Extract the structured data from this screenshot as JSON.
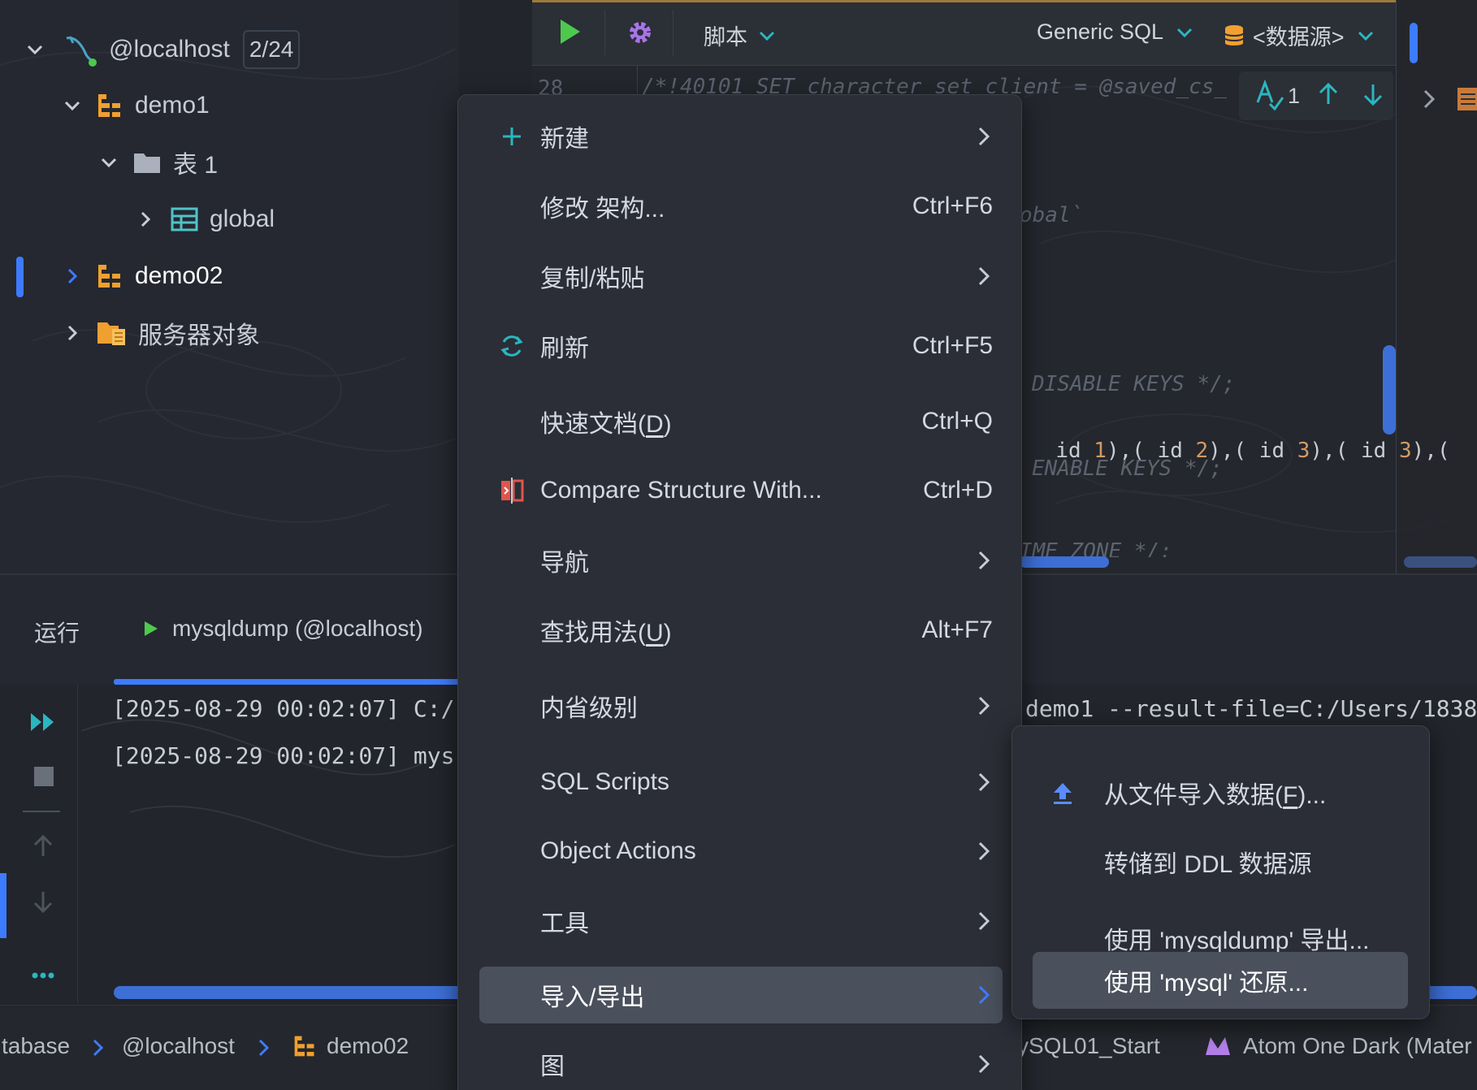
{
  "colors": {
    "accent": "#3d7bff",
    "folder_orange": "#f0a030",
    "run_green": "#4ec94e",
    "gear_purple": "#a874e8",
    "teal": "#2bb6c0",
    "compare_red": "#e0554a",
    "menu_bg": "#2b2e36",
    "active_bg": "#4a505c"
  },
  "tree": {
    "connection": {
      "label": "@localhost",
      "badge": "2/24",
      "icon": "mysql-dolphin-icon"
    },
    "schema1": {
      "label": "demo1"
    },
    "tables_folder": {
      "label": "表  1"
    },
    "table_global": {
      "label": "global"
    },
    "schema2": {
      "label": "demo02"
    },
    "server_objects": {
      "label": "服务器对象"
    }
  },
  "toolbar": {
    "script_label": "脚本",
    "dialect_label": "Generic SQL",
    "datasource_label": "<数据源>"
  },
  "editor": {
    "line_number": "28",
    "line1": "/*!40101 SET character_set_client = @saved_cs_",
    "line2": "obal`",
    "line3": "DISABLE KEYS */;",
    "line4_parts": [
      "id ",
      "1",
      "),( id ",
      "2",
      "),( id ",
      "3",
      "),( id ",
      "3",
      "),("
    ],
    "line5": "ENABLE KEYS */;",
    "line6": "IME_ZONE */;",
    "find_count": "1"
  },
  "run_panel": {
    "label": "运行",
    "tab_label": "mysqldump (@localhost)",
    "console_line1_left": "[2025-08-29 00:02:07] C:/",
    "console_line2_left": "[2025-08-29 00:02:07] mys",
    "console_line1_right": "demo1 --result-file=C:/Users/1838"
  },
  "statusbar": {
    "crumb_database": "tabase",
    "crumb_host": "@localhost",
    "crumb_schema": "demo02",
    "project": "ySQL01_Start",
    "theme": "Atom One Dark (Mater"
  },
  "context_menu": {
    "items": [
      {
        "label": "新建",
        "icon": "plus-icon",
        "arrow": true
      },
      {
        "label": "修改 架构...",
        "shortcut": "Ctrl+F6"
      },
      {
        "label": "复制/粘贴",
        "arrow": true
      },
      {
        "label": "刷新",
        "icon": "refresh-icon",
        "shortcut": "Ctrl+F5"
      },
      {
        "label_pre": "快速文档(",
        "label_mn": "D",
        "label_post": ")",
        "shortcut": "Ctrl+Q"
      },
      {
        "label": "Compare Structure With...",
        "icon": "compare-icon",
        "shortcut": "Ctrl+D"
      },
      {
        "label": "导航",
        "arrow": true
      },
      {
        "label_pre": "查找用法(",
        "label_mn": "U",
        "label_post": ")",
        "shortcut": "Alt+F7"
      },
      {
        "label": "内省级别",
        "arrow": true
      },
      {
        "label": "SQL Scripts",
        "arrow": true
      },
      {
        "label": "Object Actions",
        "arrow": true
      },
      {
        "label": "工具",
        "arrow": true
      },
      {
        "label": "导入/导出",
        "arrow": true,
        "active": true
      },
      {
        "label": "图",
        "arrow": true
      }
    ]
  },
  "submenu": {
    "items": [
      {
        "label_pre": "从文件导入数据(",
        "label_mn": "F",
        "label_post": ")...",
        "icon": "upload-icon"
      },
      {
        "label": "转储到 DDL 数据源"
      },
      {
        "label": "使用 'mysqldump' 导出..."
      },
      {
        "label": "使用 'mysql' 还原...",
        "active": true
      }
    ]
  }
}
